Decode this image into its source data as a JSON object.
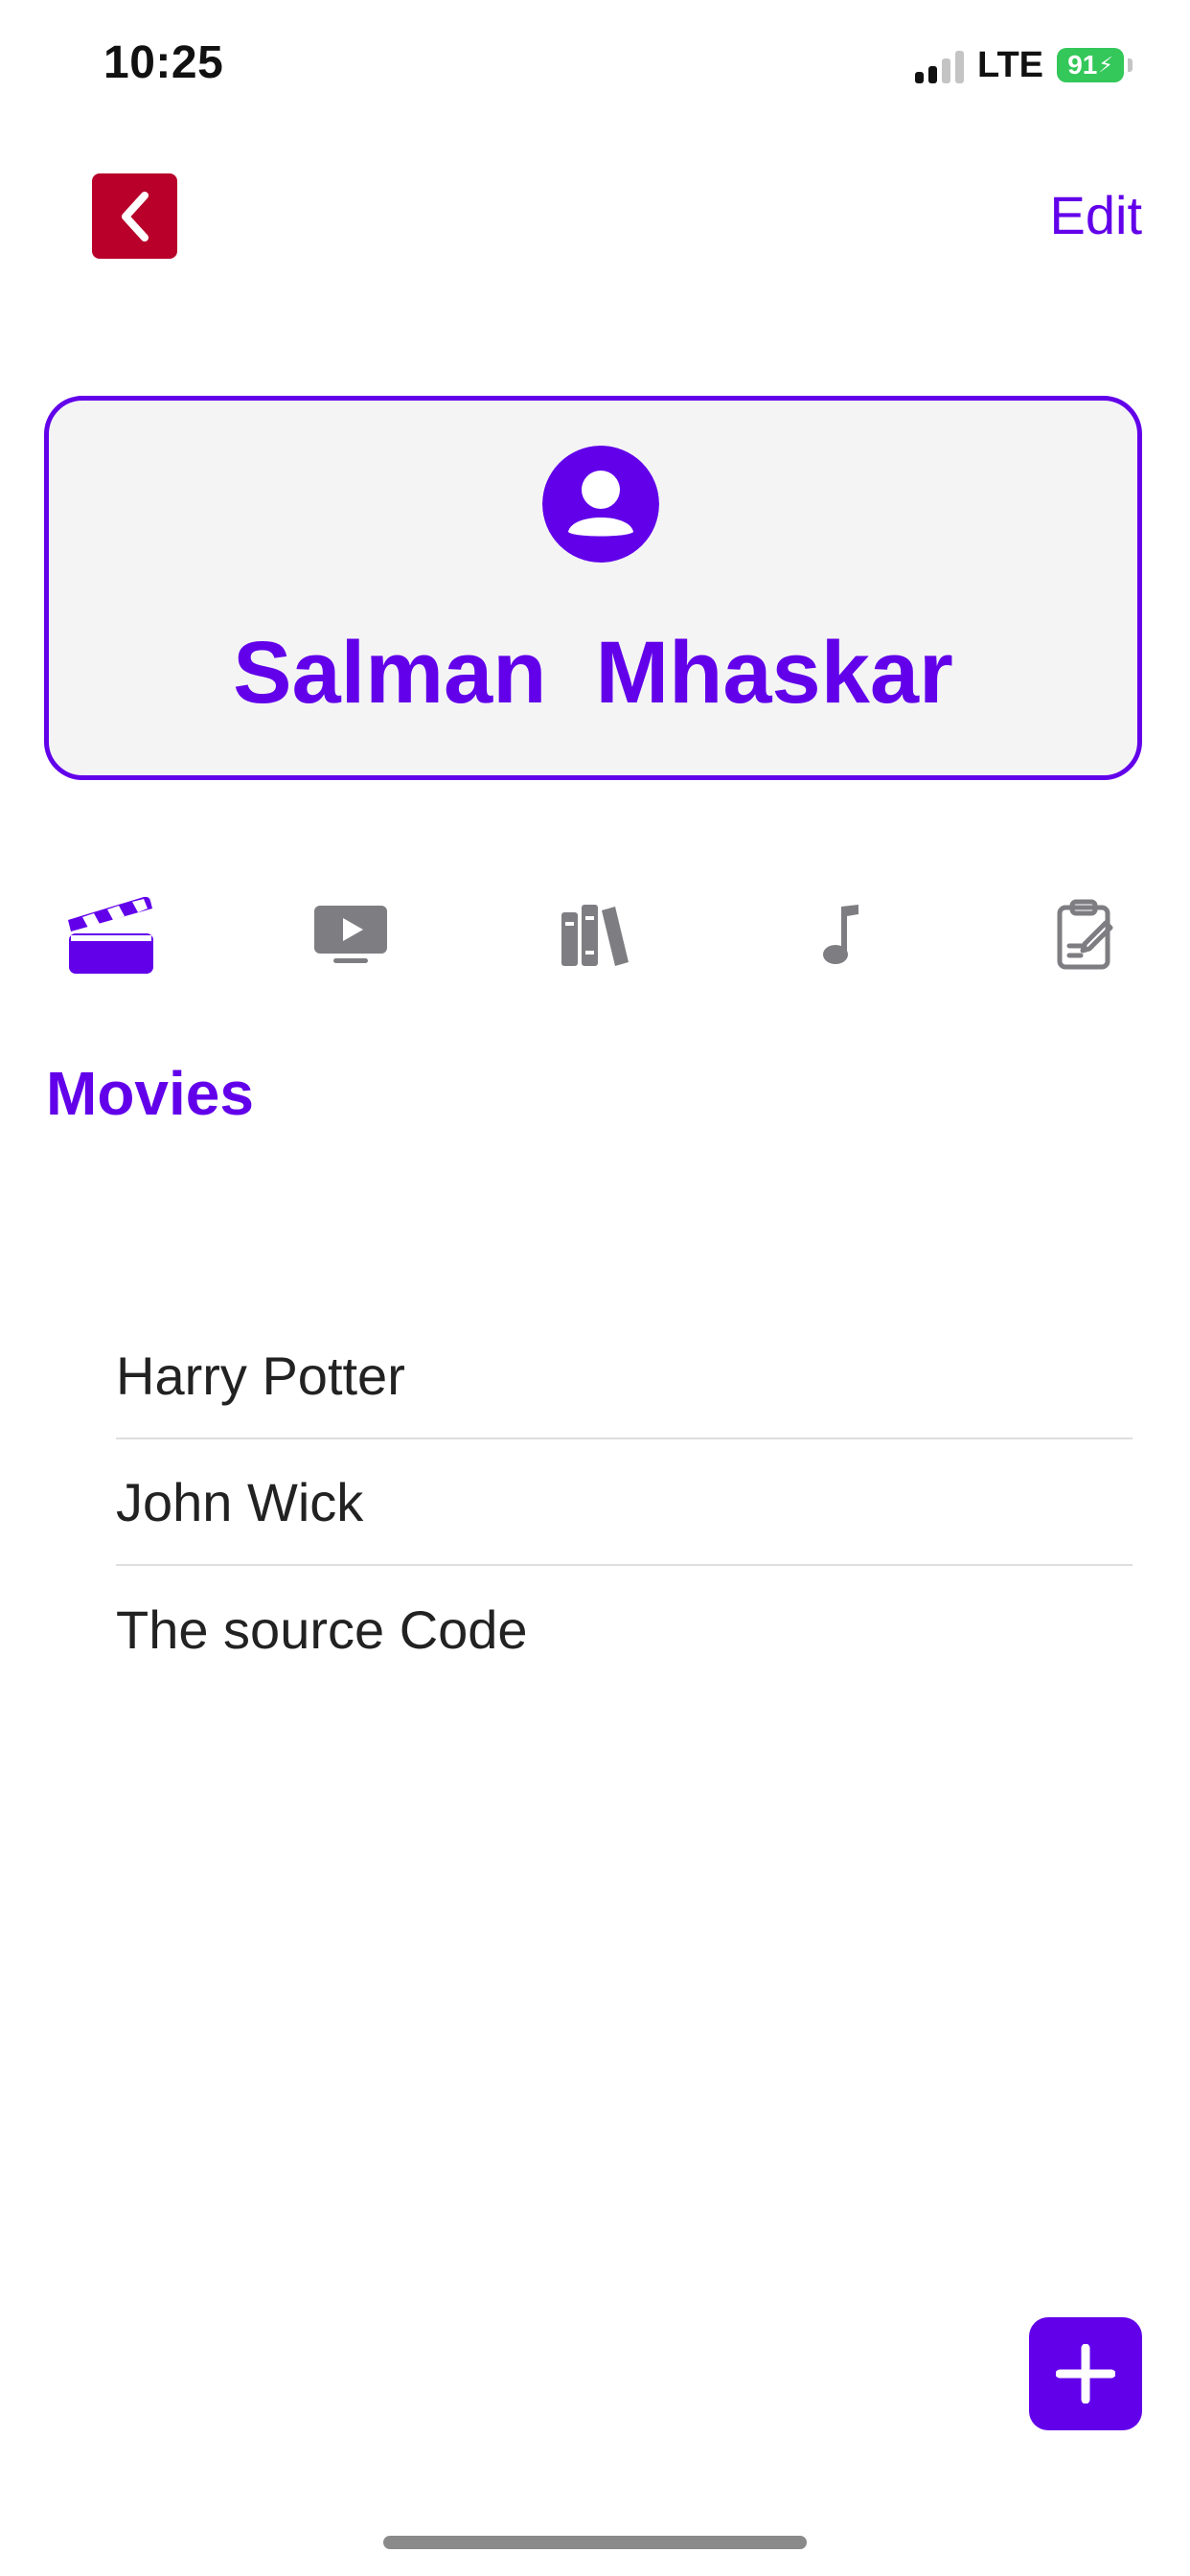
{
  "colors": {
    "accent": "#6200ea",
    "back_button": "#b8002a",
    "tab_inactive": "#7e7e82",
    "battery": "#34c759",
    "card_background": "#f4f4f4"
  },
  "status_bar": {
    "time": "10:25",
    "network": "LTE",
    "battery": "91",
    "signal_bars_active": 2,
    "signal_bars_total": 4
  },
  "nav": {
    "back_icon": "chevron-left-icon",
    "edit_label": "Edit"
  },
  "profile": {
    "avatar_icon": "person-circle-icon",
    "name": "Salman  Mhaskar"
  },
  "tabs": [
    {
      "name": "movies",
      "icon": "clapperboard-icon",
      "selected": true
    },
    {
      "name": "tv-shows",
      "icon": "tv-play-icon",
      "selected": false
    },
    {
      "name": "books",
      "icon": "books-icon",
      "selected": false
    },
    {
      "name": "music",
      "icon": "music-note-icon",
      "selected": false
    },
    {
      "name": "notes",
      "icon": "clipboard-pencil-icon",
      "selected": false
    }
  ],
  "section": {
    "title": "Movies"
  },
  "list": {
    "items": [
      "Harry Potter",
      "John Wick",
      "The source Code"
    ]
  },
  "fab": {
    "icon": "plus-icon"
  }
}
